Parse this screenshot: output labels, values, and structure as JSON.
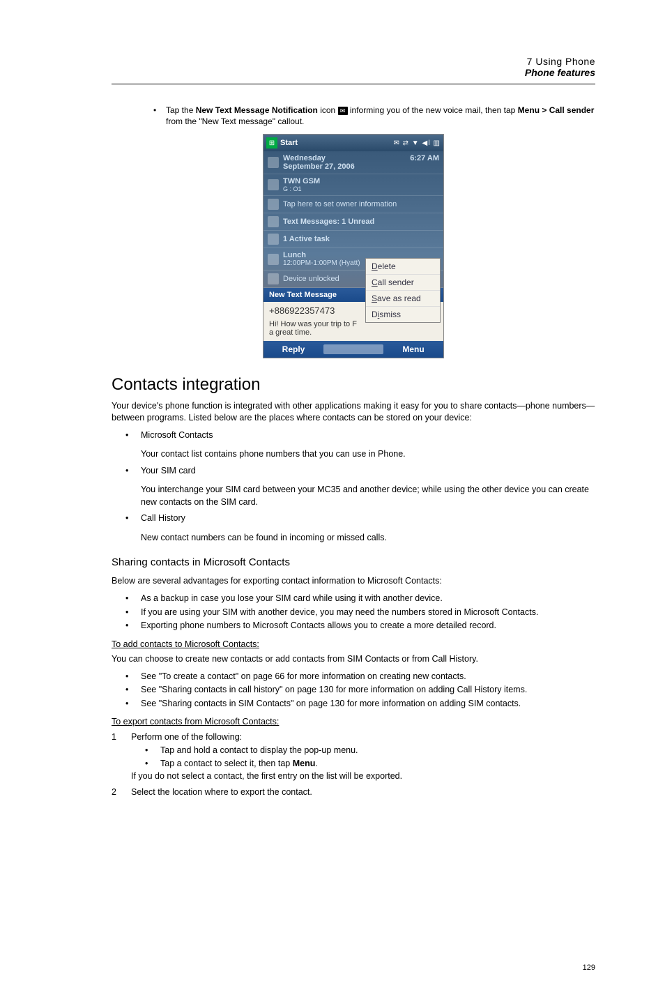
{
  "header": {
    "chapter": "7 Using Phone",
    "section": "Phone features"
  },
  "intro_bullet": {
    "pre": "Tap the ",
    "bold1": "New Text Message Notification",
    "mid1": " icon ",
    "mid2": " informing you of the new voice mail, then tap ",
    "bold2": "Menu > Call sender",
    "post": " from the \"New Text message\" callout."
  },
  "screenshot": {
    "title": "Start",
    "time": "6:27 AM",
    "day": "Wednesday",
    "date": "September 27, 2006",
    "carrier": "TWN GSM",
    "signal": "G : O1",
    "owner": "Tap here to set owner information",
    "msgs": "Text Messages: 1 Unread",
    "tasks": "1 Active task",
    "appt": "Lunch",
    "appt_time": "12:00PM-1:00PM (Hyatt)",
    "lock": "Device unlocked",
    "newmsg": "New Text Message",
    "number": "+886922357473",
    "preview": "Hi! How was your trip to F a great time.",
    "menu": {
      "delete": "Delete",
      "call": "Call sender",
      "save": "Save as read",
      "dismiss": "Dismiss"
    },
    "soft_left": "Reply",
    "soft_right": "Menu"
  },
  "contacts": {
    "heading": "Contacts integration",
    "intro": "Your device's phone function is integrated with other applications making it easy for you to share contacts—phone numbers—between programs. Listed below are the places where contacts can be stored on your device:",
    "items": [
      {
        "t": "Microsoft Contacts",
        "s": "Your contact list contains phone numbers that you can use in Phone."
      },
      {
        "t": "Your SIM card",
        "s": "You interchange your SIM card between your MC35 and another device; while using the other device you can create new contacts on the SIM card."
      },
      {
        "t": "Call History",
        "s": "New contact numbers can be found in incoming or missed calls."
      }
    ]
  },
  "sharing": {
    "heading": "Sharing contacts in Microsoft Contacts",
    "intro": "Below are several advantages for exporting contact information to Microsoft Contacts:",
    "adv": [
      "As a backup in case you lose your SIM card while using it with another device.",
      "If you are using your SIM with another device, you may need the numbers stored in Microsoft Contacts.",
      "Exporting phone numbers to Microsoft Contacts allows you to create a more detailed record."
    ],
    "add_head": "To add contacts to Microsoft Contacts:",
    "add_intro": "You can choose to create new contacts or add contacts from SIM Contacts or from Call History.",
    "add_items": [
      "See \"To create a contact\" on page 66 for more information on creating new contacts.",
      "See \"Sharing contacts in call history\" on page 130 for more information on adding Call History items.",
      "See \"Sharing contacts in SIM Contacts\" on page 130 for more information on adding SIM contacts."
    ],
    "exp_head": "To export contacts from Microsoft Contacts:",
    "step1": "Perform one of the following:",
    "step1a": "Tap and hold a contact to display the pop-up menu.",
    "step1b_pre": "Tap a contact to select it, then tap ",
    "step1b_bold": "Menu",
    "step1b_post": ".",
    "step1_note": "If you do not select a contact, the first entry on the list will be exported.",
    "step2": "Select the location where to export the contact."
  },
  "page": "129"
}
